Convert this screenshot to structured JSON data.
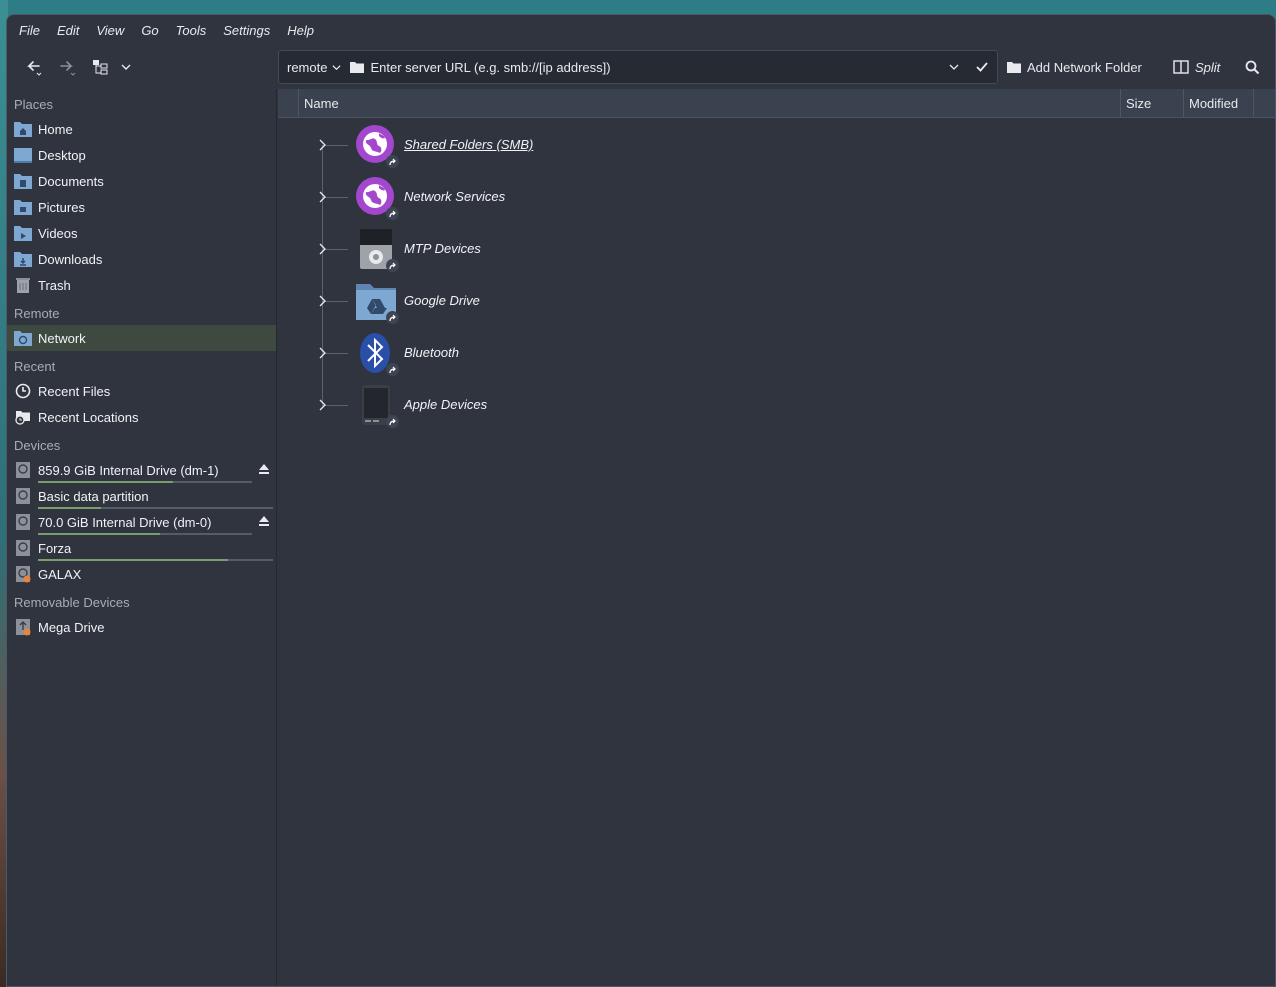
{
  "menubar": {
    "items": [
      "File",
      "Edit",
      "View",
      "Go",
      "Tools",
      "Settings",
      "Help"
    ]
  },
  "toolbar": {
    "protocol": "remote",
    "url_placeholder": "Enter server URL (e.g. smb://[ip address])",
    "add_network_folder": "Add Network Folder",
    "split": "Split"
  },
  "sidebar": {
    "places_title": "Places",
    "places": [
      {
        "label": "Home",
        "icon": "home-folder-icon"
      },
      {
        "label": "Desktop",
        "icon": "desktop-icon"
      },
      {
        "label": "Documents",
        "icon": "documents-folder-icon"
      },
      {
        "label": "Pictures",
        "icon": "pictures-folder-icon"
      },
      {
        "label": "Videos",
        "icon": "videos-folder-icon"
      },
      {
        "label": "Downloads",
        "icon": "downloads-folder-icon"
      },
      {
        "label": "Trash",
        "icon": "trash-icon"
      }
    ],
    "remote_title": "Remote",
    "remote": [
      {
        "label": "Network",
        "icon": "network-folder-icon"
      }
    ],
    "recent_title": "Recent",
    "recent": [
      {
        "label": "Recent Files",
        "icon": "clock-icon"
      },
      {
        "label": "Recent Locations",
        "icon": "recent-locations-icon"
      }
    ],
    "devices_title": "Devices",
    "devices": [
      {
        "label": "859.9 GiB Internal Drive (dm-1)",
        "usage": 0.63,
        "eject": true
      },
      {
        "label": "Basic data partition",
        "usage": 0.27,
        "eject": false
      },
      {
        "label": "70.0 GiB Internal Drive (dm-0)",
        "usage": 0.57,
        "eject": true
      },
      {
        "label": "Forza",
        "usage": 0.81,
        "eject": false
      },
      {
        "label": "GALAX",
        "usage": null,
        "eject": false
      }
    ],
    "removable_title": "Removable Devices",
    "removable": [
      {
        "label": "Mega Drive"
      }
    ]
  },
  "columns": {
    "name": "Name",
    "size": "Size",
    "modified": "Modified"
  },
  "rows": [
    {
      "label": "Shared Folders (SMB)",
      "icon": "globe-icon"
    },
    {
      "label": "Network Services",
      "icon": "globe-icon"
    },
    {
      "label": "MTP Devices",
      "icon": "media-player-icon"
    },
    {
      "label": "Google Drive",
      "icon": "google-drive-folder-icon"
    },
    {
      "label": "Bluetooth",
      "icon": "bluetooth-icon"
    },
    {
      "label": "Apple Devices",
      "icon": "phone-icon"
    }
  ],
  "colors": {
    "accent": "#a347cf",
    "window_bg": "#2f343f",
    "header_bg": "#3a4250",
    "folder_blue": "#7ea7d2"
  }
}
